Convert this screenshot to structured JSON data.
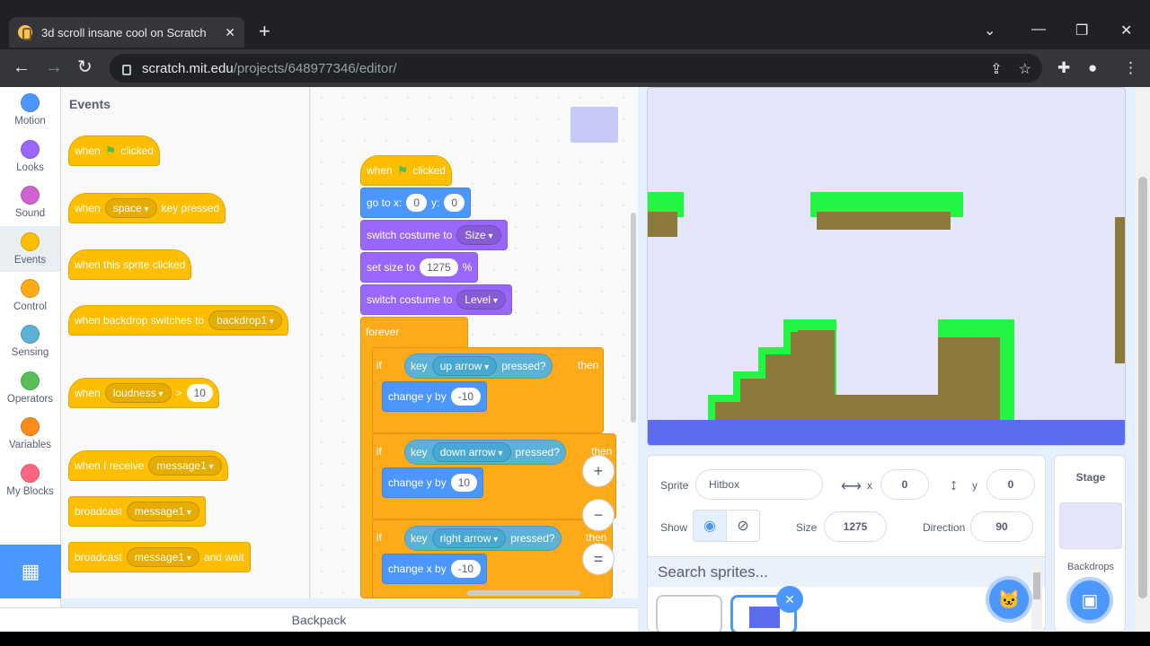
{
  "browser": {
    "tab_title": "3d scroll insane cool on Scratch",
    "url_host": "scratch.mit.edu",
    "url_path": "/projects/648977346/editor/"
  },
  "categories": [
    {
      "label": "Motion",
      "color": "#4c97ff"
    },
    {
      "label": "Looks",
      "color": "#9966ff"
    },
    {
      "label": "Sound",
      "color": "#cf63cf"
    },
    {
      "label": "Events",
      "color": "#ffbf00"
    },
    {
      "label": "Control",
      "color": "#ffab19"
    },
    {
      "label": "Sensing",
      "color": "#5cb1d6"
    },
    {
      "label": "Operators",
      "color": "#59c059"
    },
    {
      "label": "Variables",
      "color": "#ff8c1a"
    },
    {
      "label": "My Blocks",
      "color": "#ff6680"
    }
  ],
  "palette": {
    "heading": "Events",
    "flag_block": {
      "w1": "when",
      "w2": "clicked"
    },
    "key_block": {
      "w1": "when",
      "key": "space",
      "w2": "key pressed"
    },
    "sprite_clicked": "when this sprite clicked",
    "backdrop_block": {
      "w1": "when backdrop switches to",
      "value": "backdrop1"
    },
    "loudness_block": {
      "w1": "when",
      "sensor": "loudness",
      "op": ">",
      "value": "10"
    },
    "receive_block": {
      "w1": "when I receive",
      "msg": "message1"
    },
    "broadcast_block": {
      "w1": "broadcast",
      "msg": "message1"
    },
    "broadcast_wait_block": {
      "w1": "broadcast",
      "msg": "message1",
      "w2": "and wait"
    }
  },
  "script": {
    "hat": {
      "w1": "when",
      "w2": "clicked"
    },
    "goto": {
      "w1": "go to x:",
      "x": "0",
      "w2": "y:",
      "y": "0"
    },
    "costume1": {
      "w1": "switch costume to",
      "value": "Size"
    },
    "setsize": {
      "w1": "set size to",
      "value": "1275",
      "w2": "%"
    },
    "costume2": {
      "w1": "switch costume to",
      "value": "Level"
    },
    "forever": "forever",
    "if1": {
      "if": "if",
      "key": "key",
      "value": "up arrow",
      "pressed": "pressed?",
      "then": "then",
      "action": "change y by",
      "amount": "-10"
    },
    "if2": {
      "if": "if",
      "key": "key",
      "value": "down arrow",
      "pressed": "pressed?",
      "then": "then",
      "action": "change y by",
      "amount": "10"
    },
    "if3": {
      "if": "if",
      "key": "key",
      "value": "right arrow",
      "pressed": "pressed?",
      "then": "then",
      "action": "change x by",
      "amount": "-10"
    }
  },
  "zoom": {
    "in": "+",
    "out": "−",
    "reset": "="
  },
  "backpack": "Backpack",
  "sprite_info": {
    "sprite_label": "Sprite",
    "sprite_name": "Hitbox",
    "x_label": "x",
    "x": "0",
    "y_label": "y",
    "y": "0",
    "show_label": "Show",
    "size_label": "Size",
    "size": "1275",
    "direction_label": "Direction",
    "direction": "90",
    "search_placeholder": "Search sprites..."
  },
  "stage_panel": {
    "title": "Stage",
    "backdrops": "Backdrops"
  },
  "colors": {
    "stage_bg": "#e4e4fa",
    "grass": "#22f542",
    "dirt": "#8b7a3a",
    "water": "#5c6cf0"
  }
}
